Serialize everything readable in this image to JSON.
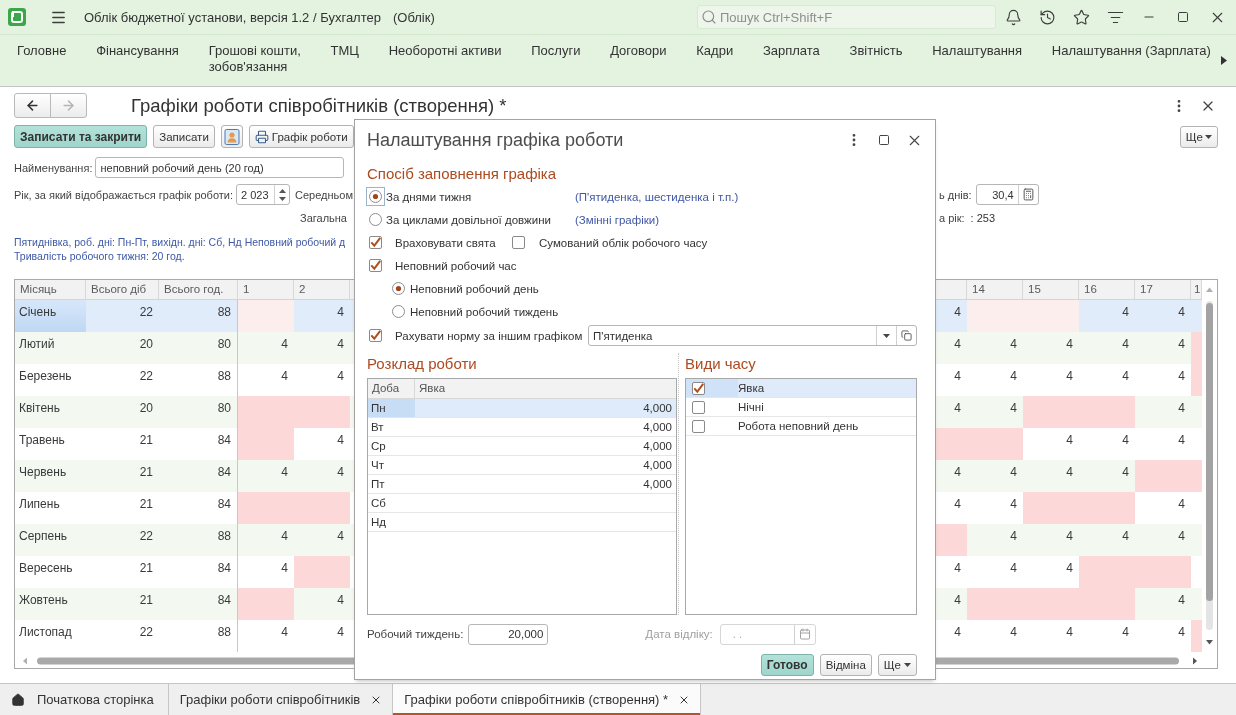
{
  "window": {
    "title": "Облік бюджетної установи, версія 1.2 / Бухгалтер",
    "context": "(Облік)",
    "search": {
      "placeholder": "Пошук Ctrl+Shift+F"
    }
  },
  "sections": [
    {
      "label": "Головне"
    },
    {
      "label": "Фінансування"
    },
    {
      "label": "Грошові кошти,\nзобов'язання"
    },
    {
      "label": "ТМЦ"
    },
    {
      "label": "Необоротні активи"
    },
    {
      "label": "Послуги"
    },
    {
      "label": "Договори"
    },
    {
      "label": "Кадри"
    },
    {
      "label": "Зарплата"
    },
    {
      "label": "Звітність"
    },
    {
      "label": "Налаштування"
    },
    {
      "label": "Налаштування (Зарплата)"
    }
  ],
  "form": {
    "title": "Графіки роботи співробітників (створення) *",
    "navigation": {
      "back": {
        "disabled": false
      },
      "forward": {
        "disabled": true
      }
    },
    "toolbar": [
      {
        "kind": "save_close",
        "label": "Записати та закрити"
      },
      {
        "kind": "save",
        "label": "Записати"
      },
      {
        "kind": "card"
      },
      {
        "kind": "print",
        "label": "Графік роботи"
      }
    ],
    "more_button": {
      "label": "Ще"
    },
    "name_field": {
      "label": "Найменування:",
      "value": "неповний робочий день (20 год)"
    },
    "year_field": {
      "label": "Рік, за який відображається графік роботи:",
      "value": "2 023"
    },
    "average_days": {
      "label_left": "Середньом",
      "label_right": "ь днів:",
      "value": "30,4"
    },
    "total_days": {
      "label_left": "Загальна",
      "label_right": "а рік:",
      "value": ": 253"
    },
    "summary": [
      "Пятиднівка, роб. дні: Пн-Пт, вихідн. дні: Сб, Нд Неповний робочий д",
      "Тривалість робочого тижня: 20 год."
    ],
    "table": {
      "columns": [
        "Місяць",
        "Всього діб",
        "Всього год."
      ],
      "day_columns_left": [
        "1",
        "2"
      ],
      "day_columns_right": [
        {
          "kind": "partial"
        },
        {
          "kind": "day",
          "label": "14"
        },
        {
          "kind": "day",
          "label": "15"
        },
        {
          "kind": "day",
          "label": "16"
        },
        {
          "kind": "day",
          "label": "17"
        },
        {
          "kind": "edge",
          "label": "1"
        }
      ],
      "rows": [
        {
          "month": "Січень",
          "days": "22",
          "hours": "88",
          "selected": true,
          "left": [
            {
              "off": true
            },
            {
              "value": "4",
              "off": false
            }
          ],
          "right": [
            {
              "value": "4",
              "off": false
            },
            {
              "off": true
            },
            {
              "off": true
            },
            {
              "value": "4",
              "off": false
            },
            {
              "value": "4",
              "off": false
            },
            {
              "off": false
            }
          ]
        },
        {
          "month": "Лютий",
          "days": "20",
          "hours": "80",
          "selected": false,
          "left": [
            {
              "value": "4",
              "off": false
            },
            {
              "value": "4",
              "off": false
            }
          ],
          "right": [
            {
              "value": "4",
              "off": false
            },
            {
              "value": "4",
              "off": false
            },
            {
              "value": "4",
              "off": false
            },
            {
              "value": "4",
              "off": false
            },
            {
              "value": "4",
              "off": false
            },
            {
              "off": true
            }
          ]
        },
        {
          "month": "Березень",
          "days": "22",
          "hours": "88",
          "selected": false,
          "left": [
            {
              "value": "4",
              "off": false
            },
            {
              "value": "4",
              "off": false
            }
          ],
          "right": [
            {
              "value": "4",
              "off": false
            },
            {
              "value": "4",
              "off": false
            },
            {
              "value": "4",
              "off": false
            },
            {
              "value": "4",
              "off": false
            },
            {
              "value": "4",
              "off": false
            },
            {
              "off": true
            }
          ]
        },
        {
          "month": "Квітень",
          "days": "20",
          "hours": "80",
          "selected": false,
          "left": [
            {
              "off": true
            },
            {
              "off": true
            }
          ],
          "right": [
            {
              "value": "4",
              "off": false
            },
            {
              "value": "4",
              "off": false
            },
            {
              "off": true
            },
            {
              "off": true
            },
            {
              "value": "4",
              "off": false
            },
            {
              "off": false
            }
          ]
        },
        {
          "month": "Травень",
          "days": "21",
          "hours": "84",
          "selected": false,
          "left": [
            {
              "off": true
            },
            {
              "value": "4",
              "off": false
            }
          ],
          "right": [
            {
              "off": true
            },
            {
              "off": true
            },
            {
              "value": "4",
              "off": false
            },
            {
              "value": "4",
              "off": false
            },
            {
              "value": "4",
              "off": false
            },
            {
              "off": false
            }
          ]
        },
        {
          "month": "Червень",
          "days": "21",
          "hours": "84",
          "selected": false,
          "left": [
            {
              "value": "4",
              "off": false
            },
            {
              "value": "4",
              "off": false
            }
          ],
          "right": [
            {
              "value": "4",
              "off": false
            },
            {
              "value": "4",
              "off": false
            },
            {
              "value": "4",
              "off": false
            },
            {
              "value": "4",
              "off": false
            },
            {
              "off": true
            },
            {
              "off": true
            }
          ]
        },
        {
          "month": "Липень",
          "days": "21",
          "hours": "84",
          "selected": false,
          "left": [
            {
              "off": true
            },
            {
              "off": true
            }
          ],
          "right": [
            {
              "value": "4",
              "off": false
            },
            {
              "value": "4",
              "off": false
            },
            {
              "off": true
            },
            {
              "off": true
            },
            {
              "value": "4",
              "off": false
            },
            {
              "off": false
            }
          ]
        },
        {
          "month": "Серпень",
          "days": "22",
          "hours": "88",
          "selected": false,
          "left": [
            {
              "value": "4",
              "off": false
            },
            {
              "value": "4",
              "off": false
            }
          ],
          "right": [
            {
              "off": true
            },
            {
              "value": "4",
              "off": false
            },
            {
              "value": "4",
              "off": false
            },
            {
              "value": "4",
              "off": false
            },
            {
              "value": "4",
              "off": false
            },
            {
              "off": false
            }
          ]
        },
        {
          "month": "Вересень",
          "days": "21",
          "hours": "84",
          "selected": false,
          "left": [
            {
              "value": "4",
              "off": false
            },
            {
              "off": true
            }
          ],
          "right": [
            {
              "value": "4",
              "off": false
            },
            {
              "value": "4",
              "off": false
            },
            {
              "value": "4",
              "off": false
            },
            {
              "off": true
            },
            {
              "off": true
            },
            {
              "off": false
            }
          ]
        },
        {
          "month": "Жовтень",
          "days": "21",
          "hours": "84",
          "selected": false,
          "left": [
            {
              "off": true
            },
            {
              "value": "4",
              "off": false
            }
          ],
          "right": [
            {
              "value": "4",
              "off": false
            },
            {
              "off": true
            },
            {
              "off": true
            },
            {
              "off": true
            },
            {
              "value": "4",
              "off": false
            },
            {
              "off": false
            }
          ]
        },
        {
          "month": "Листопад",
          "days": "22",
          "hours": "88",
          "selected": false,
          "left": [
            {
              "value": "4",
              "off": false
            },
            {
              "value": "4",
              "off": false
            }
          ],
          "right": [
            {
              "value": "4",
              "off": false
            },
            {
              "value": "4",
              "off": false
            },
            {
              "value": "4",
              "off": false
            },
            {
              "value": "4",
              "off": false
            },
            {
              "value": "4",
              "off": false
            },
            {
              "off": true
            }
          ]
        }
      ]
    }
  },
  "dialog": {
    "title": "Налаштування графіка роботи",
    "fill_method": {
      "heading": "Спосіб заповнення графіка",
      "options": [
        {
          "label": "За днями тижня",
          "hint": "(П'ятиденка, шестиденка і т.п.)",
          "selected": true,
          "focused": true
        },
        {
          "label": "За циклами довільної довжини",
          "hint": "(Змінні графіки)",
          "selected": false,
          "focused": false
        }
      ]
    },
    "holidays": {
      "label": "Враховувати свята",
      "checked": true
    },
    "summarized": {
      "label": "Сумований облік робочого часу",
      "checked": false
    },
    "part_time": {
      "label": "Неповний робочий час",
      "checked": true,
      "options": [
        {
          "label": "Неповний робочий день",
          "selected": true
        },
        {
          "label": "Неповний робочий тиждень",
          "selected": false
        }
      ]
    },
    "other_norm": {
      "label": "Рахувати норму за іншим графіком",
      "checked": true,
      "value": "П'ятиденка"
    },
    "schedule": {
      "heading": "Розклад роботи",
      "columns": [
        "Доба",
        "Явка"
      ],
      "rows": [
        {
          "day": "Пн",
          "hours": "4,000",
          "selected": true
        },
        {
          "day": "Вт",
          "hours": "4,000",
          "selected": false
        },
        {
          "day": "Ср",
          "hours": "4,000",
          "selected": false
        },
        {
          "day": "Чт",
          "hours": "4,000",
          "selected": false
        },
        {
          "day": "Пт",
          "hours": "4,000",
          "selected": false
        },
        {
          "day": "Сб",
          "selected": false
        },
        {
          "day": "Нд",
          "selected": false
        }
      ]
    },
    "time_types": {
      "heading": "Види часу",
      "items": [
        {
          "label": "Явка",
          "checked": true,
          "selected": true
        },
        {
          "label": "Нічні",
          "checked": false,
          "selected": false
        },
        {
          "label": "Робота неповний день",
          "checked": false,
          "selected": false
        }
      ]
    },
    "work_week": {
      "label": "Робочий тиждень:",
      "value": "20,000"
    },
    "start_date": {
      "label": "Дата відліку:",
      "placeholder": ". .",
      "disabled": true
    },
    "buttons": [
      {
        "kind": "done",
        "label": "Готово"
      },
      {
        "kind": "cancel",
        "label": "Відміна"
      },
      {
        "kind": "more",
        "label": "Ще"
      }
    ]
  },
  "tabs": [
    {
      "kind": "home",
      "label": "Початкова сторінка",
      "selected": false
    },
    {
      "kind": "page",
      "label": "Графіки роботи співробітників",
      "selected": false
    },
    {
      "kind": "page",
      "label": "Графіки роботи співробітників (створення) *",
      "selected": true
    }
  ]
}
